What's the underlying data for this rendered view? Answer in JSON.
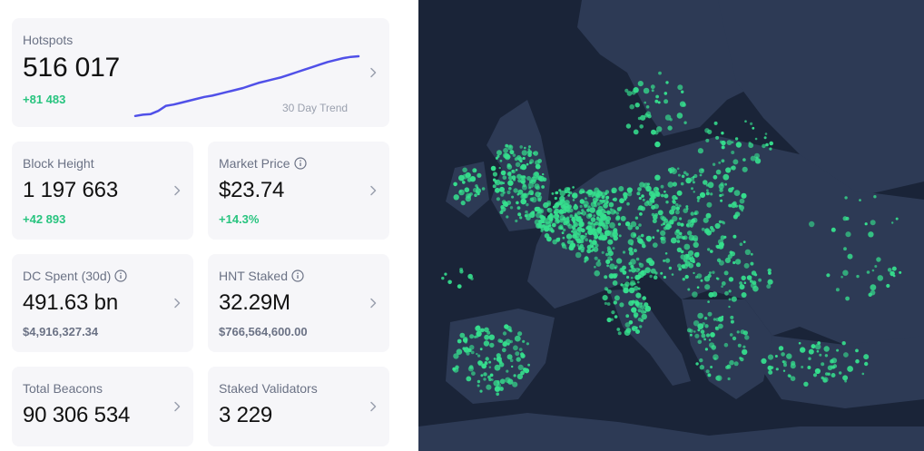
{
  "stats": {
    "hotspots": {
      "label": "Hotspots",
      "value": "516 017",
      "delta": "+81 483",
      "trend_caption": "30 Day Trend",
      "trend": [
        0.06,
        0.08,
        0.09,
        0.14,
        0.22,
        0.24,
        0.27,
        0.3,
        0.33,
        0.36,
        0.38,
        0.41,
        0.44,
        0.47,
        0.5,
        0.54,
        0.58,
        0.61,
        0.64,
        0.67,
        0.71,
        0.75,
        0.79,
        0.83,
        0.87,
        0.91,
        0.94,
        0.97,
        0.99,
        1.0
      ]
    },
    "block_height": {
      "label": "Block Height",
      "value": "1 197 663",
      "delta": "+42 893"
    },
    "market_price": {
      "label": "Market Price",
      "value": "$23.74",
      "delta": "+14.3%"
    },
    "dc_spent": {
      "label": "DC Spent (30d)",
      "value": "491.63 bn",
      "sub": "$4,916,327.34"
    },
    "hnt_staked": {
      "label": "HNT Staked",
      "value": "32.29M",
      "sub": "$766,564,600.00"
    },
    "total_beacons": {
      "label": "Total Beacons",
      "value": "90 306 534"
    },
    "staked_validators": {
      "label": "Staked Validators",
      "value": "3 229"
    }
  },
  "colors": {
    "accent_line": "#5050e8",
    "positive": "#28c47f",
    "card_bg": "#f6f6f9",
    "map_sea": "#1a2438",
    "map_land": "#2d3a55",
    "hotspot": "#36e08e"
  },
  "map": {
    "icon": "hotspot-coverage-map"
  }
}
